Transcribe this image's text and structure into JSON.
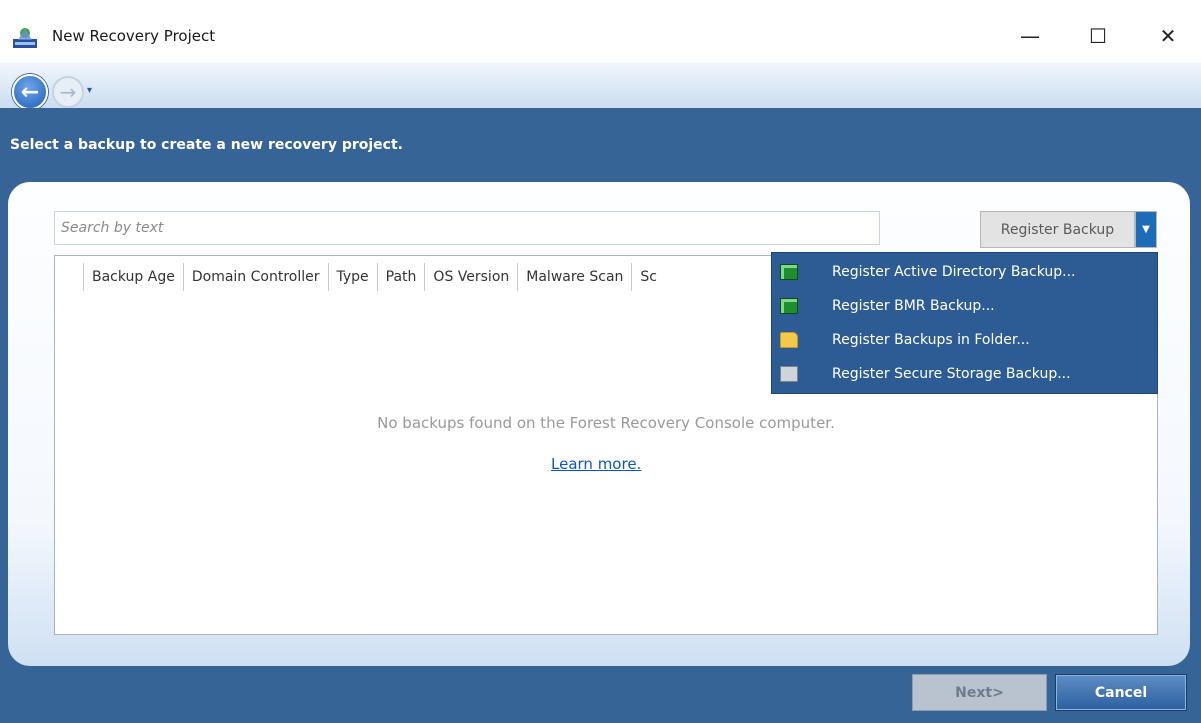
{
  "window": {
    "title": "New Recovery Project",
    "minimize": "—",
    "maximize": "☐",
    "close": "✕"
  },
  "nav": {
    "back_icon": "arrow-left-icon",
    "forward_icon": "arrow-right-icon",
    "back_glyph": "←",
    "forward_glyph": "→",
    "history_glyph": "▾"
  },
  "instruction": "Select a backup to create a new recovery project.",
  "search": {
    "placeholder": "Search by text",
    "value": ""
  },
  "register_button": {
    "label": "Register Backup",
    "dropdown_glyph": "▼"
  },
  "table": {
    "columns": [
      "Backup Age",
      "Domain Controller",
      "Type",
      "Path",
      "OS Version",
      "Malware Scan",
      "Sc"
    ],
    "empty_message": "No backups found on the Forest Recovery Console computer.",
    "learn_more": "Learn more."
  },
  "register_menu": {
    "items": [
      {
        "label": "Register Active Directory Backup...",
        "icon": "floppy-disk-icon"
      },
      {
        "label": "Register BMR Backup...",
        "icon": "floppy-disk-icon"
      },
      {
        "label": "Register Backups in Folder...",
        "icon": "folder-open-icon"
      },
      {
        "label": "Register Secure Storage Backup...",
        "icon": "storage-server-icon"
      }
    ]
  },
  "footer": {
    "next": "Next>",
    "cancel": "Cancel"
  },
  "colors": {
    "main_background": "#376497",
    "menu_background": "#2d5c95",
    "link": "#0b57c5"
  }
}
